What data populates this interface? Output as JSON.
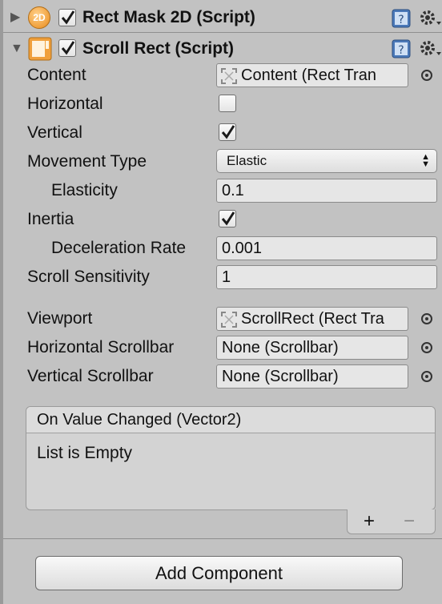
{
  "components": {
    "rect_mask": {
      "badge": "2D",
      "enabled": true,
      "title": "Rect Mask 2D (Script)"
    },
    "scroll_rect": {
      "enabled": true,
      "title": "Scroll Rect (Script)"
    }
  },
  "fields": {
    "content": {
      "label": "Content",
      "value": "Content (Rect Tran"
    },
    "horizontal": {
      "label": "Horizontal",
      "checked": false
    },
    "vertical": {
      "label": "Vertical",
      "checked": true
    },
    "movement_type": {
      "label": "Movement Type",
      "value": "Elastic"
    },
    "elasticity": {
      "label": "Elasticity",
      "value": "0.1"
    },
    "inertia": {
      "label": "Inertia",
      "checked": true
    },
    "deceleration_rate": {
      "label": "Deceleration Rate",
      "value": "0.001"
    },
    "scroll_sensitivity": {
      "label": "Scroll Sensitivity",
      "value": "1"
    },
    "viewport": {
      "label": "Viewport",
      "value": "ScrollRect (Rect Tra"
    },
    "horizontal_scrollbar": {
      "label": "Horizontal Scrollbar",
      "value": "None (Scrollbar)"
    },
    "vertical_scrollbar": {
      "label": "Vertical Scrollbar",
      "value": "None (Scrollbar)"
    }
  },
  "events": {
    "title": "On Value Changed (Vector2)",
    "empty_text": "List is Empty",
    "plus": "+",
    "minus": "−"
  },
  "add_component": {
    "label": "Add Component"
  },
  "colors": {
    "background": "#c2c2c2",
    "field": "#e6e6e6",
    "script_icon_orange": "#f0a03c",
    "help_icon_blue": "#4a78b8",
    "check": "#1a1a1a"
  }
}
